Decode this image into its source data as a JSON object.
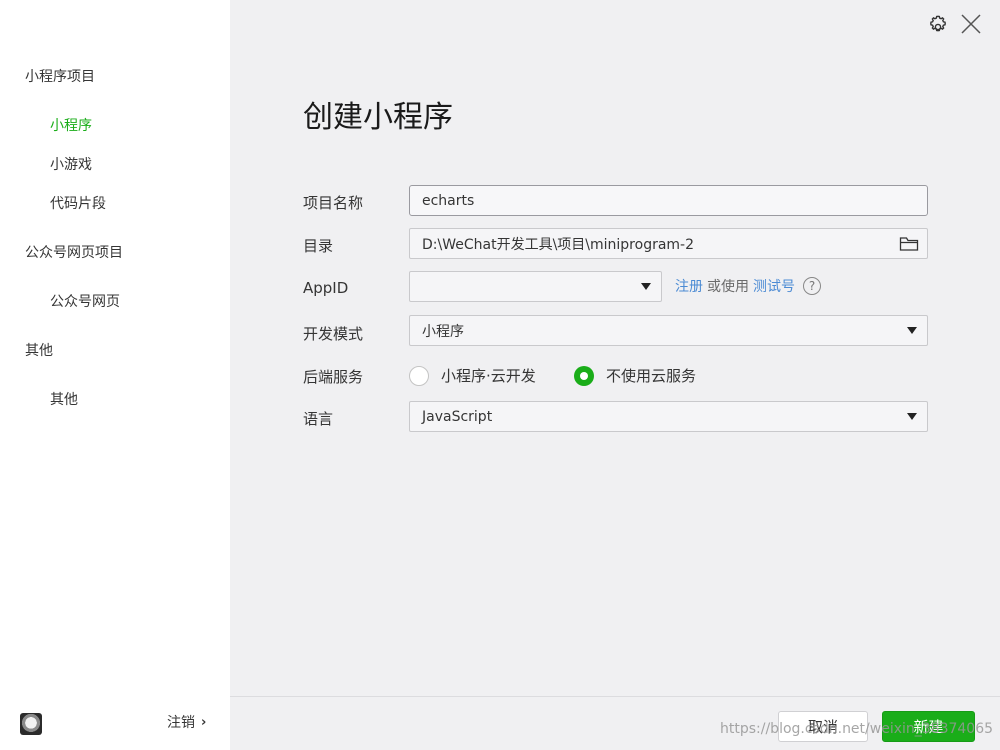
{
  "sidebar": {
    "groups": [
      {
        "label": "小程序项目",
        "items": [
          "小程序",
          "小游戏",
          "代码片段"
        ]
      },
      {
        "label": "公众号网页项目",
        "items": [
          "公众号网页"
        ]
      },
      {
        "label": "其他",
        "items": [
          "其他"
        ]
      }
    ],
    "active_item": "小程序",
    "logout_label": "注销"
  },
  "main": {
    "title": "创建小程序",
    "form": {
      "project_name": {
        "label": "项目名称",
        "value": "echarts"
      },
      "directory": {
        "label": "目录",
        "value": "D:\\WeChat开发工具\\项目\\miniprogram-2"
      },
      "appid": {
        "label": "AppID",
        "value": "",
        "register_link": "注册",
        "or_use": "或使用",
        "test_link": "测试号",
        "help": "?"
      },
      "dev_mode": {
        "label": "开发模式",
        "value": "小程序"
      },
      "backend": {
        "label": "后端服务",
        "options": [
          "小程序·云开发",
          "不使用云服务"
        ],
        "selected": "不使用云服务"
      },
      "language": {
        "label": "语言",
        "value": "JavaScript"
      }
    }
  },
  "footer": {
    "cancel_label": "取消",
    "create_label": "新建",
    "watermark": "https://blog.csdn.net/weixin_38374065"
  },
  "colors": {
    "accent": "#1aad19",
    "link": "#4c8bd4",
    "main_bg": "#f0f0f2"
  },
  "icons": {
    "settings": "gear-icon",
    "close": "close-icon",
    "folder": "folder-icon",
    "dropdown": "caret-down-icon",
    "help": "help-circle-icon"
  }
}
